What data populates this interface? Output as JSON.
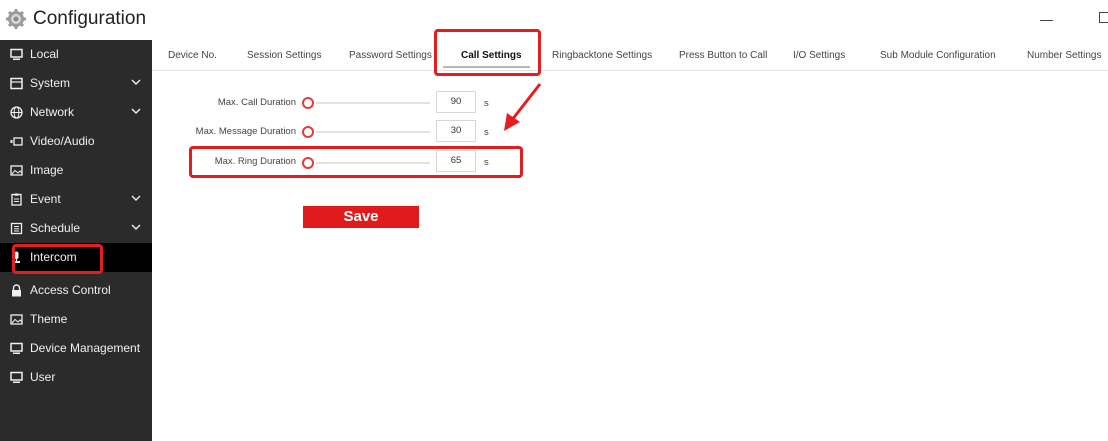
{
  "app": {
    "title": "Configuration"
  },
  "sidebar": {
    "items": [
      {
        "label": "Local",
        "icon": "monitor-icon",
        "expandable": false
      },
      {
        "label": "System",
        "icon": "system-icon",
        "expandable": true
      },
      {
        "label": "Network",
        "icon": "globe-icon",
        "expandable": true
      },
      {
        "label": "Video/Audio",
        "icon": "video-icon",
        "expandable": false
      },
      {
        "label": "Image",
        "icon": "image-icon",
        "expandable": false
      },
      {
        "label": "Event",
        "icon": "event-icon",
        "expandable": true
      },
      {
        "label": "Schedule",
        "icon": "schedule-icon",
        "expandable": true
      },
      {
        "label": "Intercom",
        "icon": "microphone-icon",
        "expandable": false,
        "active": true
      },
      {
        "label": "Access Control",
        "icon": "lock-icon",
        "expandable": false
      },
      {
        "label": "Theme",
        "icon": "image-icon",
        "expandable": false
      },
      {
        "label": "Device Management",
        "icon": "monitor-icon",
        "expandable": false
      },
      {
        "label": "User",
        "icon": "monitor-icon",
        "expandable": false
      }
    ]
  },
  "tabs": [
    {
      "label": "Device No."
    },
    {
      "label": "Session Settings"
    },
    {
      "label": "Password Settings"
    },
    {
      "label": "Call Settings",
      "active": true
    },
    {
      "label": "Ringbacktone Settings"
    },
    {
      "label": "Press Button to Call"
    },
    {
      "label": "I/O Settings"
    },
    {
      "label": "Sub Module Configuration"
    },
    {
      "label": "Number Settings"
    }
  ],
  "form": {
    "fields": [
      {
        "label": "Max. Call Duration",
        "value": "90",
        "unit": "s"
      },
      {
        "label": "Max. Message Duration",
        "value": "30",
        "unit": "s"
      },
      {
        "label": "Max. Ring Duration",
        "value": "65",
        "unit": "s"
      }
    ],
    "save_label": "Save"
  },
  "colors": {
    "accent": "#e11b1b",
    "sidebar_bg": "#2b2b2b",
    "sidebar_active": "#000000",
    "annotation": "#e41e1e"
  }
}
